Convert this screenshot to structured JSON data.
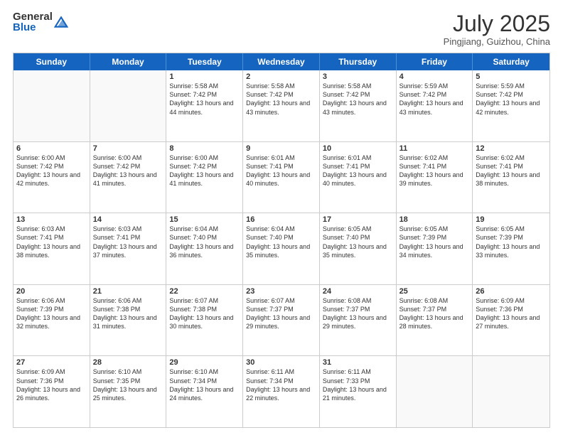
{
  "header": {
    "logo_general": "General",
    "logo_blue": "Blue",
    "month": "July 2025",
    "location": "Pingjiang, Guizhou, China"
  },
  "weekdays": [
    "Sunday",
    "Monday",
    "Tuesday",
    "Wednesday",
    "Thursday",
    "Friday",
    "Saturday"
  ],
  "rows": [
    [
      {
        "day": "",
        "empty": true
      },
      {
        "day": "",
        "empty": true
      },
      {
        "day": "1",
        "sunrise": "Sunrise: 5:58 AM",
        "sunset": "Sunset: 7:42 PM",
        "daylight": "Daylight: 13 hours and 44 minutes."
      },
      {
        "day": "2",
        "sunrise": "Sunrise: 5:58 AM",
        "sunset": "Sunset: 7:42 PM",
        "daylight": "Daylight: 13 hours and 43 minutes."
      },
      {
        "day": "3",
        "sunrise": "Sunrise: 5:58 AM",
        "sunset": "Sunset: 7:42 PM",
        "daylight": "Daylight: 13 hours and 43 minutes."
      },
      {
        "day": "4",
        "sunrise": "Sunrise: 5:59 AM",
        "sunset": "Sunset: 7:42 PM",
        "daylight": "Daylight: 13 hours and 43 minutes."
      },
      {
        "day": "5",
        "sunrise": "Sunrise: 5:59 AM",
        "sunset": "Sunset: 7:42 PM",
        "daylight": "Daylight: 13 hours and 42 minutes."
      }
    ],
    [
      {
        "day": "6",
        "sunrise": "Sunrise: 6:00 AM",
        "sunset": "Sunset: 7:42 PM",
        "daylight": "Daylight: 13 hours and 42 minutes."
      },
      {
        "day": "7",
        "sunrise": "Sunrise: 6:00 AM",
        "sunset": "Sunset: 7:42 PM",
        "daylight": "Daylight: 13 hours and 41 minutes."
      },
      {
        "day": "8",
        "sunrise": "Sunrise: 6:00 AM",
        "sunset": "Sunset: 7:42 PM",
        "daylight": "Daylight: 13 hours and 41 minutes."
      },
      {
        "day": "9",
        "sunrise": "Sunrise: 6:01 AM",
        "sunset": "Sunset: 7:41 PM",
        "daylight": "Daylight: 13 hours and 40 minutes."
      },
      {
        "day": "10",
        "sunrise": "Sunrise: 6:01 AM",
        "sunset": "Sunset: 7:41 PM",
        "daylight": "Daylight: 13 hours and 40 minutes."
      },
      {
        "day": "11",
        "sunrise": "Sunrise: 6:02 AM",
        "sunset": "Sunset: 7:41 PM",
        "daylight": "Daylight: 13 hours and 39 minutes."
      },
      {
        "day": "12",
        "sunrise": "Sunrise: 6:02 AM",
        "sunset": "Sunset: 7:41 PM",
        "daylight": "Daylight: 13 hours and 38 minutes."
      }
    ],
    [
      {
        "day": "13",
        "sunrise": "Sunrise: 6:03 AM",
        "sunset": "Sunset: 7:41 PM",
        "daylight": "Daylight: 13 hours and 38 minutes."
      },
      {
        "day": "14",
        "sunrise": "Sunrise: 6:03 AM",
        "sunset": "Sunset: 7:41 PM",
        "daylight": "Daylight: 13 hours and 37 minutes."
      },
      {
        "day": "15",
        "sunrise": "Sunrise: 6:04 AM",
        "sunset": "Sunset: 7:40 PM",
        "daylight": "Daylight: 13 hours and 36 minutes."
      },
      {
        "day": "16",
        "sunrise": "Sunrise: 6:04 AM",
        "sunset": "Sunset: 7:40 PM",
        "daylight": "Daylight: 13 hours and 35 minutes."
      },
      {
        "day": "17",
        "sunrise": "Sunrise: 6:05 AM",
        "sunset": "Sunset: 7:40 PM",
        "daylight": "Daylight: 13 hours and 35 minutes."
      },
      {
        "day": "18",
        "sunrise": "Sunrise: 6:05 AM",
        "sunset": "Sunset: 7:39 PM",
        "daylight": "Daylight: 13 hours and 34 minutes."
      },
      {
        "day": "19",
        "sunrise": "Sunrise: 6:05 AM",
        "sunset": "Sunset: 7:39 PM",
        "daylight": "Daylight: 13 hours and 33 minutes."
      }
    ],
    [
      {
        "day": "20",
        "sunrise": "Sunrise: 6:06 AM",
        "sunset": "Sunset: 7:39 PM",
        "daylight": "Daylight: 13 hours and 32 minutes."
      },
      {
        "day": "21",
        "sunrise": "Sunrise: 6:06 AM",
        "sunset": "Sunset: 7:38 PM",
        "daylight": "Daylight: 13 hours and 31 minutes."
      },
      {
        "day": "22",
        "sunrise": "Sunrise: 6:07 AM",
        "sunset": "Sunset: 7:38 PM",
        "daylight": "Daylight: 13 hours and 30 minutes."
      },
      {
        "day": "23",
        "sunrise": "Sunrise: 6:07 AM",
        "sunset": "Sunset: 7:37 PM",
        "daylight": "Daylight: 13 hours and 29 minutes."
      },
      {
        "day": "24",
        "sunrise": "Sunrise: 6:08 AM",
        "sunset": "Sunset: 7:37 PM",
        "daylight": "Daylight: 13 hours and 29 minutes."
      },
      {
        "day": "25",
        "sunrise": "Sunrise: 6:08 AM",
        "sunset": "Sunset: 7:37 PM",
        "daylight": "Daylight: 13 hours and 28 minutes."
      },
      {
        "day": "26",
        "sunrise": "Sunrise: 6:09 AM",
        "sunset": "Sunset: 7:36 PM",
        "daylight": "Daylight: 13 hours and 27 minutes."
      }
    ],
    [
      {
        "day": "27",
        "sunrise": "Sunrise: 6:09 AM",
        "sunset": "Sunset: 7:36 PM",
        "daylight": "Daylight: 13 hours and 26 minutes."
      },
      {
        "day": "28",
        "sunrise": "Sunrise: 6:10 AM",
        "sunset": "Sunset: 7:35 PM",
        "daylight": "Daylight: 13 hours and 25 minutes."
      },
      {
        "day": "29",
        "sunrise": "Sunrise: 6:10 AM",
        "sunset": "Sunset: 7:34 PM",
        "daylight": "Daylight: 13 hours and 24 minutes."
      },
      {
        "day": "30",
        "sunrise": "Sunrise: 6:11 AM",
        "sunset": "Sunset: 7:34 PM",
        "daylight": "Daylight: 13 hours and 22 minutes."
      },
      {
        "day": "31",
        "sunrise": "Sunrise: 6:11 AM",
        "sunset": "Sunset: 7:33 PM",
        "daylight": "Daylight: 13 hours and 21 minutes."
      },
      {
        "day": "",
        "empty": true
      },
      {
        "day": "",
        "empty": true
      }
    ]
  ]
}
